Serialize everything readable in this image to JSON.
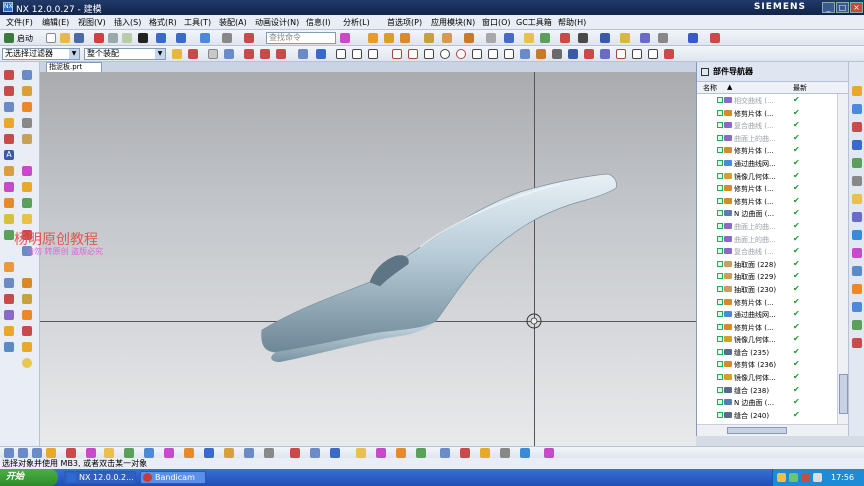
{
  "window": {
    "title": "NX 12.0.0.27 - 建模",
    "brand": "SIEMENS"
  },
  "menu": [
    "文件(F)",
    "编辑(E)",
    "视图(V)",
    "插入(S)",
    "格式(R)",
    "工具(T)",
    "装配(A)",
    "动画设计(N)",
    "信息(I)",
    "分析(L)",
    "首选项(P)",
    "应用模块(N)",
    "窗口(O)",
    "GC工具箱",
    "帮助(H)"
  ],
  "toolbar": {
    "start_label": "启动",
    "search_placeholder": "查找命令"
  },
  "filters": {
    "type_filter": "无选择过滤器",
    "scope_filter": "整个装配"
  },
  "tab": {
    "file_name": "指泥板.prt"
  },
  "watermark": {
    "line1": "杨明原创教程",
    "line2": "请勿 转原创 盗版必究"
  },
  "navigator": {
    "title": "部件导航器",
    "col_name": "名称",
    "col_latest": "最新",
    "rows": [
      {
        "name": "相交曲线 (...",
        "dim": true,
        "icon": "#8a6ac8"
      },
      {
        "name": "修剪片体 (...",
        "dim": false,
        "icon": "#d38c2a"
      },
      {
        "name": "复合曲线 (...",
        "dim": true,
        "icon": "#8a6ac8"
      },
      {
        "name": "曲面上的曲...",
        "dim": true,
        "icon": "#8a6ac8"
      },
      {
        "name": "修剪片体 (...",
        "dim": false,
        "icon": "#d38c2a"
      },
      {
        "name": "通过曲线网...",
        "dim": false,
        "icon": "#4a8ad8"
      },
      {
        "name": "镜像几何体...",
        "dim": false,
        "icon": "#d3a02a"
      },
      {
        "name": "修剪片体 (...",
        "dim": false,
        "icon": "#d38c2a"
      },
      {
        "name": "修剪片体 (...",
        "dim": false,
        "icon": "#d38c2a"
      },
      {
        "name": "N 边曲面 (...",
        "dim": false,
        "icon": "#5a7ab8"
      },
      {
        "name": "曲面上的曲...",
        "dim": true,
        "icon": "#8a6ac8"
      },
      {
        "name": "曲面上的曲...",
        "dim": true,
        "icon": "#8a6ac8"
      },
      {
        "name": "复合曲线 (...",
        "dim": true,
        "icon": "#8a6ac8"
      },
      {
        "name": "抽取面 (228)",
        "dim": false,
        "icon": "#c8a05a"
      },
      {
        "name": "抽取面 (229)",
        "dim": false,
        "icon": "#c8a05a"
      },
      {
        "name": "抽取面 (230)",
        "dim": false,
        "icon": "#c8a05a"
      },
      {
        "name": "修剪片体 (...",
        "dim": false,
        "icon": "#d38c2a"
      },
      {
        "name": "通过曲线网...",
        "dim": false,
        "icon": "#4a8ad8"
      },
      {
        "name": "修剪片体 (...",
        "dim": false,
        "icon": "#d38c2a"
      },
      {
        "name": "镜像几何体...",
        "dim": false,
        "icon": "#d3a02a"
      },
      {
        "name": "缝合 (235)",
        "dim": false,
        "icon": "#5a6a88"
      },
      {
        "name": "修剪体 (236)",
        "dim": false,
        "icon": "#d38c2a"
      },
      {
        "name": "镜像几何体...",
        "dim": false,
        "icon": "#d3a02a"
      },
      {
        "name": "缝合 (238)",
        "dim": false,
        "icon": "#5a6a88"
      },
      {
        "name": "N 边曲面 (...",
        "dim": false,
        "icon": "#5a7ab8"
      },
      {
        "name": "缝合 (240)",
        "dim": false,
        "icon": "#5a6a88"
      }
    ]
  },
  "status": {
    "prompt": "选择对象并使用 MB3, 或者双击某一对象"
  },
  "taskbar": {
    "start_label": "开始",
    "tasks": [
      "NX 12.0.0.2...",
      "Bandicam"
    ],
    "time": "17:56"
  }
}
